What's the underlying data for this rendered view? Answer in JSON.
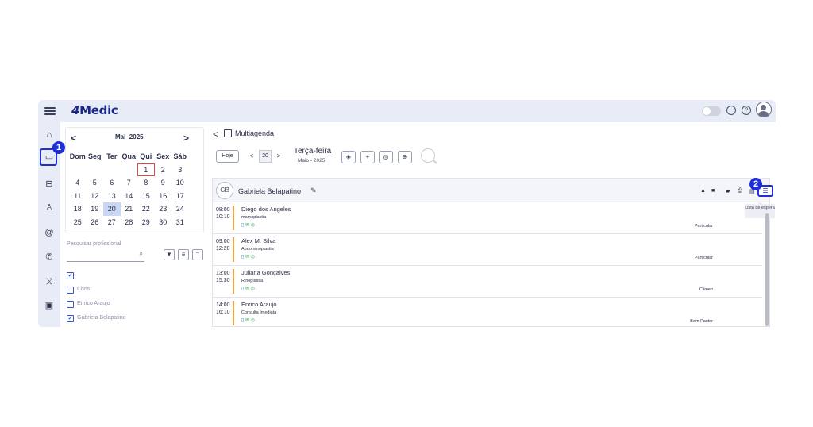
{
  "brand": {
    "logo_prefix": "4",
    "logo_name": "Medic"
  },
  "markers": {
    "first": "1",
    "second": "2"
  },
  "calendar": {
    "month": "Mai",
    "year": "2025",
    "prev": "<",
    "next": ">",
    "weekdays": [
      "Dom",
      "Seg",
      "Ter",
      "Qua",
      "Qui",
      "Sex",
      "Sáb"
    ],
    "weeks": [
      [
        "",
        "",
        "",
        "",
        "1",
        "2",
        "3"
      ],
      [
        "4",
        "5",
        "6",
        "7",
        "8",
        "9",
        "10"
      ],
      [
        "11",
        "12",
        "13",
        "14",
        "15",
        "16",
        "17"
      ],
      [
        "18",
        "19",
        "20",
        "21",
        "22",
        "23",
        "24"
      ],
      [
        "25",
        "26",
        "27",
        "28",
        "29",
        "30",
        "31"
      ]
    ],
    "today": "1",
    "selected": "20"
  },
  "professionals": {
    "search_placeholder": "Pesquisar profissional",
    "items": [
      {
        "label": "",
        "checked": true
      },
      {
        "label": "Chris",
        "checked": false
      },
      {
        "label": "Enrico Araujo",
        "checked": false
      },
      {
        "label": "Gabriela Belapatino",
        "checked": true
      }
    ]
  },
  "header": {
    "back": "<",
    "title": "Multiagenda"
  },
  "date_nav": {
    "today_label": "Hoje",
    "prev": "<",
    "day": "20",
    "next": ">",
    "weekday": "Terça-feira",
    "month_year": "Maio - 2025"
  },
  "agenda": {
    "initials": "GB",
    "professional": "Gabriela Belapatino",
    "tooltip": "Lista de espera",
    "appointments": [
      {
        "start": "08:00",
        "end": "10:10",
        "patient": "Diego dos Angeles",
        "procedure": "mamoplastia",
        "plan": "Particular"
      },
      {
        "start": "09:00",
        "end": "12:20",
        "patient": "Alex M. Silva",
        "procedure": "Abdominoplastia",
        "plan": "Particular"
      },
      {
        "start": "13:00",
        "end": "15:30",
        "patient": "Juliana Gonçalves",
        "procedure": "Rinoplastia",
        "plan": "Climep"
      },
      {
        "start": "14:00",
        "end": "16:10",
        "patient": "Enrico Araujo",
        "procedure": "Consulta Imediata",
        "plan": "Bom Pastor"
      }
    ]
  },
  "colors": {
    "accent": "#1f2fd6",
    "brand": "#1b2a8a",
    "bar": "#f0a44a",
    "selected_day": "#c9d6f6"
  }
}
